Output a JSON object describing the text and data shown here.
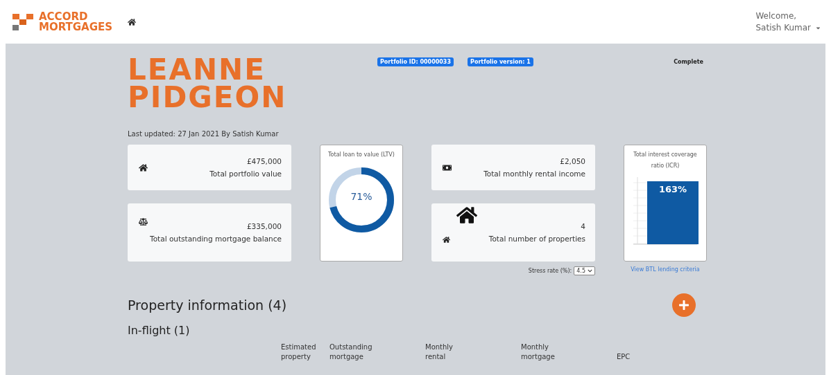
{
  "header": {
    "logo": {
      "line_1": "ACCORD",
      "line_2": "MORTGAGES"
    },
    "welcome": "Welcome,",
    "user": "Satish Kumar"
  },
  "portfolio": {
    "name_line_1": "LEANNE",
    "name_line_2": "PIDGEON",
    "last_updated": "Last updated: 27 Jan 2021 By Satish Kumar",
    "badges": [
      "Portfolio ID: 00000033",
      "Portfolio version: 1"
    ],
    "status": "Complete"
  },
  "stats": [
    {
      "kind": "home",
      "value": "£475,000",
      "label": "Total portfolio value"
    },
    {
      "kind": "money",
      "value": "£2,050",
      "label": "Total monthly rental income"
    },
    {
      "kind": "scale",
      "value": "£335,000",
      "label": "Total outstanding mortgage balance"
    },
    {
      "kind": "properties",
      "value": "4",
      "label": "Total number of properties"
    }
  ],
  "ltv": {
    "title": "Total loan to value (LTV)",
    "reading": "71%",
    "level": 0.71
  },
  "icr": {
    "title": "Total interest coverage ratio (ICR)",
    "reading": "163%"
  },
  "stress_rate": {
    "label": "Stress rate (%):",
    "value": "4.5"
  },
  "lending_link": "View BTL lending criteria",
  "property_heading": "Property information (4)",
  "in_flight_heading": "In-flight (1)",
  "table": {
    "columns": [
      "Estimated property",
      "Outstanding mortgage",
      "Monthly rental",
      "Monthly mortgage",
      "EPC"
    ]
  }
}
